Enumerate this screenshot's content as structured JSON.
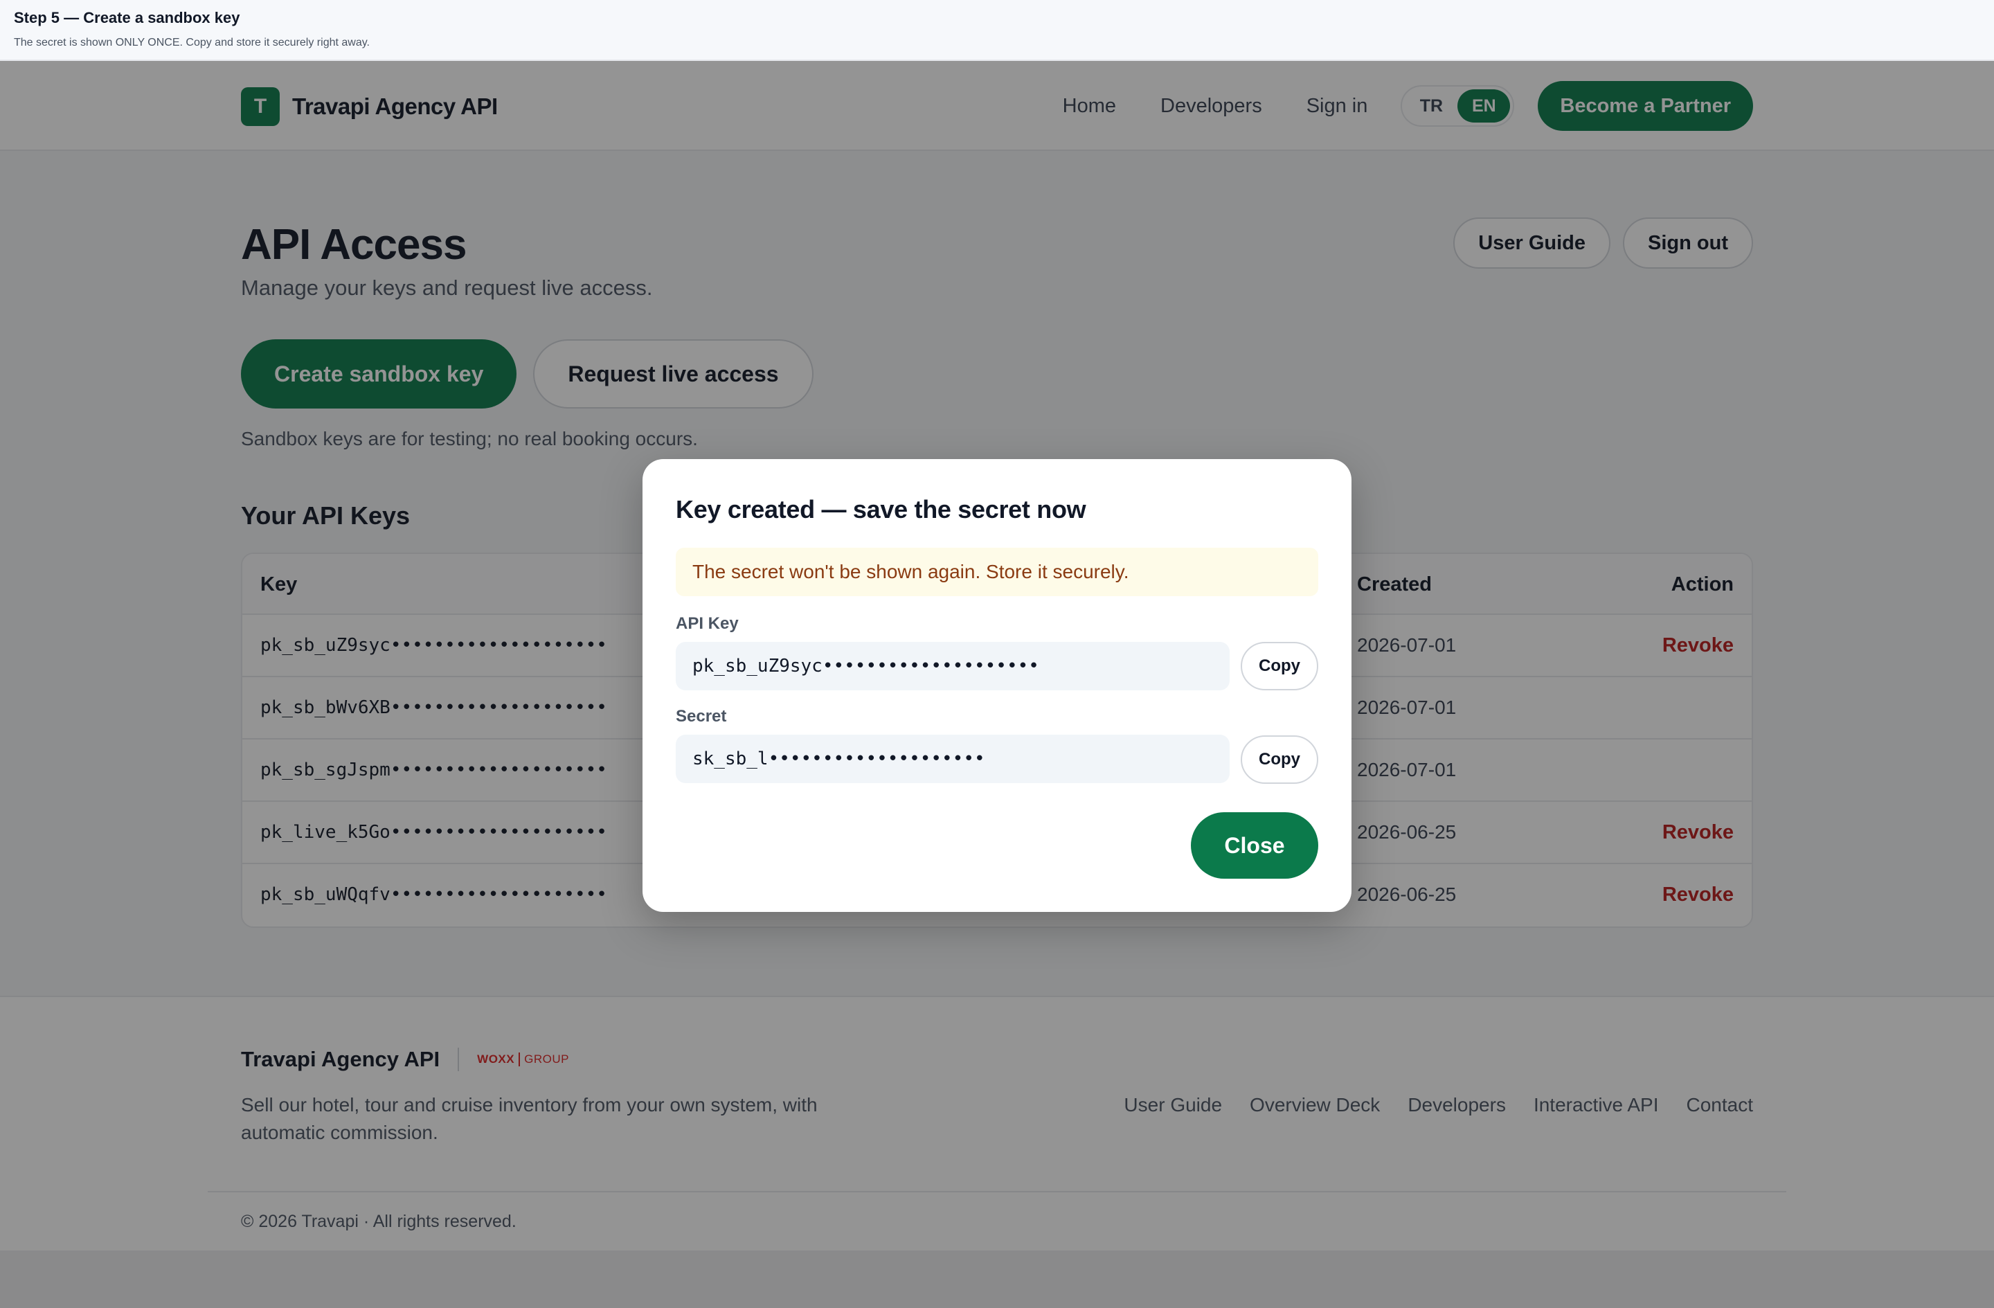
{
  "step": {
    "title": "Step 5 — Create a sandbox key",
    "subtitle": "The secret is shown ONLY ONCE. Copy and store it securely right away."
  },
  "header": {
    "logo_letter": "T",
    "brand": "Travapi Agency API",
    "nav": [
      "Home",
      "Developers",
      "Sign in"
    ],
    "languages": [
      {
        "code": "TR",
        "active": false
      },
      {
        "code": "EN",
        "active": true
      }
    ],
    "partner_label": "Become a Partner"
  },
  "main": {
    "title": "API Access",
    "subtitle": "Manage your keys and request live access.",
    "top_actions": [
      "User Guide",
      "Sign out"
    ],
    "create_label": "Create sandbox key",
    "request_label": "Request live access",
    "sandbox_note": "Sandbox keys are for testing; no real booking occurs."
  },
  "keys": {
    "title": "Your API Keys",
    "columns": {
      "key": "Key",
      "created": "Created",
      "action": "Action"
    },
    "rows": [
      {
        "key": "pk_sb_uZ9syc••••••••••••••••••••",
        "created": "2026-07-01",
        "action": "Revoke"
      },
      {
        "key": "pk_sb_bWv6XB••••••••••••••••••••",
        "created": "2026-07-01",
        "action": ""
      },
      {
        "key": "pk_sb_sgJspm••••••••••••••••••••",
        "created": "2026-07-01",
        "action": ""
      },
      {
        "key": "pk_live_k5Go••••••••••••••••••••",
        "created": "2026-06-25",
        "action": "Revoke"
      },
      {
        "key": "pk_sb_uWQqfv••••••••••••••••••••",
        "created": "2026-06-25",
        "action": "Revoke"
      }
    ]
  },
  "footer": {
    "brand": "Travapi Agency API",
    "partner_logo": {
      "main": "WOXX",
      "group": "GROUP"
    },
    "description": "Sell our hotel, tour and cruise inventory from your own system, with automatic commission.",
    "links": [
      "User Guide",
      "Overview Deck",
      "Developers",
      "Interactive API",
      "Contact"
    ],
    "copyright": "© 2026 Travapi · All rights reserved."
  },
  "modal": {
    "title": "Key created — save the secret now",
    "warning": "The secret won't be shown again. Store it securely.",
    "api_key_label": "API Key",
    "api_key_value": "pk_sb_uZ9syc••••••••••••••••••••",
    "secret_label": "Secret",
    "secret_value": "sk_sb_l••••••••••••••••••••",
    "copy_label": "Copy",
    "close_label": "Close"
  },
  "colors": {
    "brand_green": "#0b7a4b",
    "danger_red": "#b91c1c",
    "warning_bg": "#fefbe8",
    "warning_text": "#8a3b12"
  }
}
